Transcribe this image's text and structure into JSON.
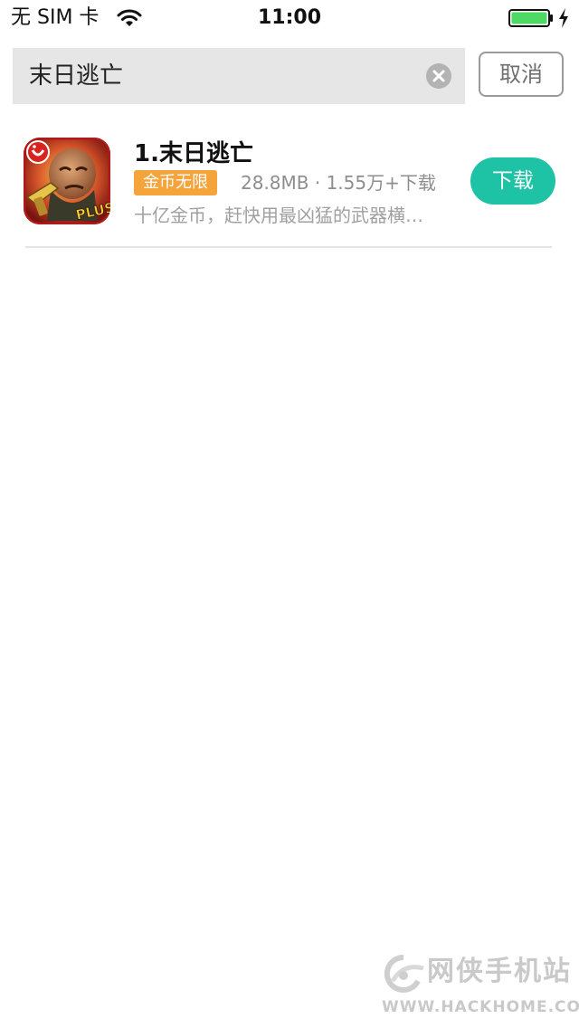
{
  "status_bar": {
    "carrier": "无 SIM 卡",
    "time": "11:00",
    "battery_color": "#4cd964"
  },
  "search": {
    "query": "末日逃亡",
    "cancel_label": "取消",
    "clear_icon": "clear-icon"
  },
  "results": [
    {
      "index": "1.",
      "name": "末日逃亡",
      "badge": "金币无限",
      "meta": "28.8MB · 1.55万+下载",
      "description": "十亿金币，赶快用最凶猛的武器横…",
      "action_label": "下载",
      "icon_text": "PLUS"
    }
  ],
  "watermark": {
    "title": "网侠手机站",
    "url": "WWW.HACKHOME.COM"
  },
  "colors": {
    "accent": "#1ec3a6",
    "badge": "#f5a33b",
    "search_bg": "#e6e6e6"
  }
}
